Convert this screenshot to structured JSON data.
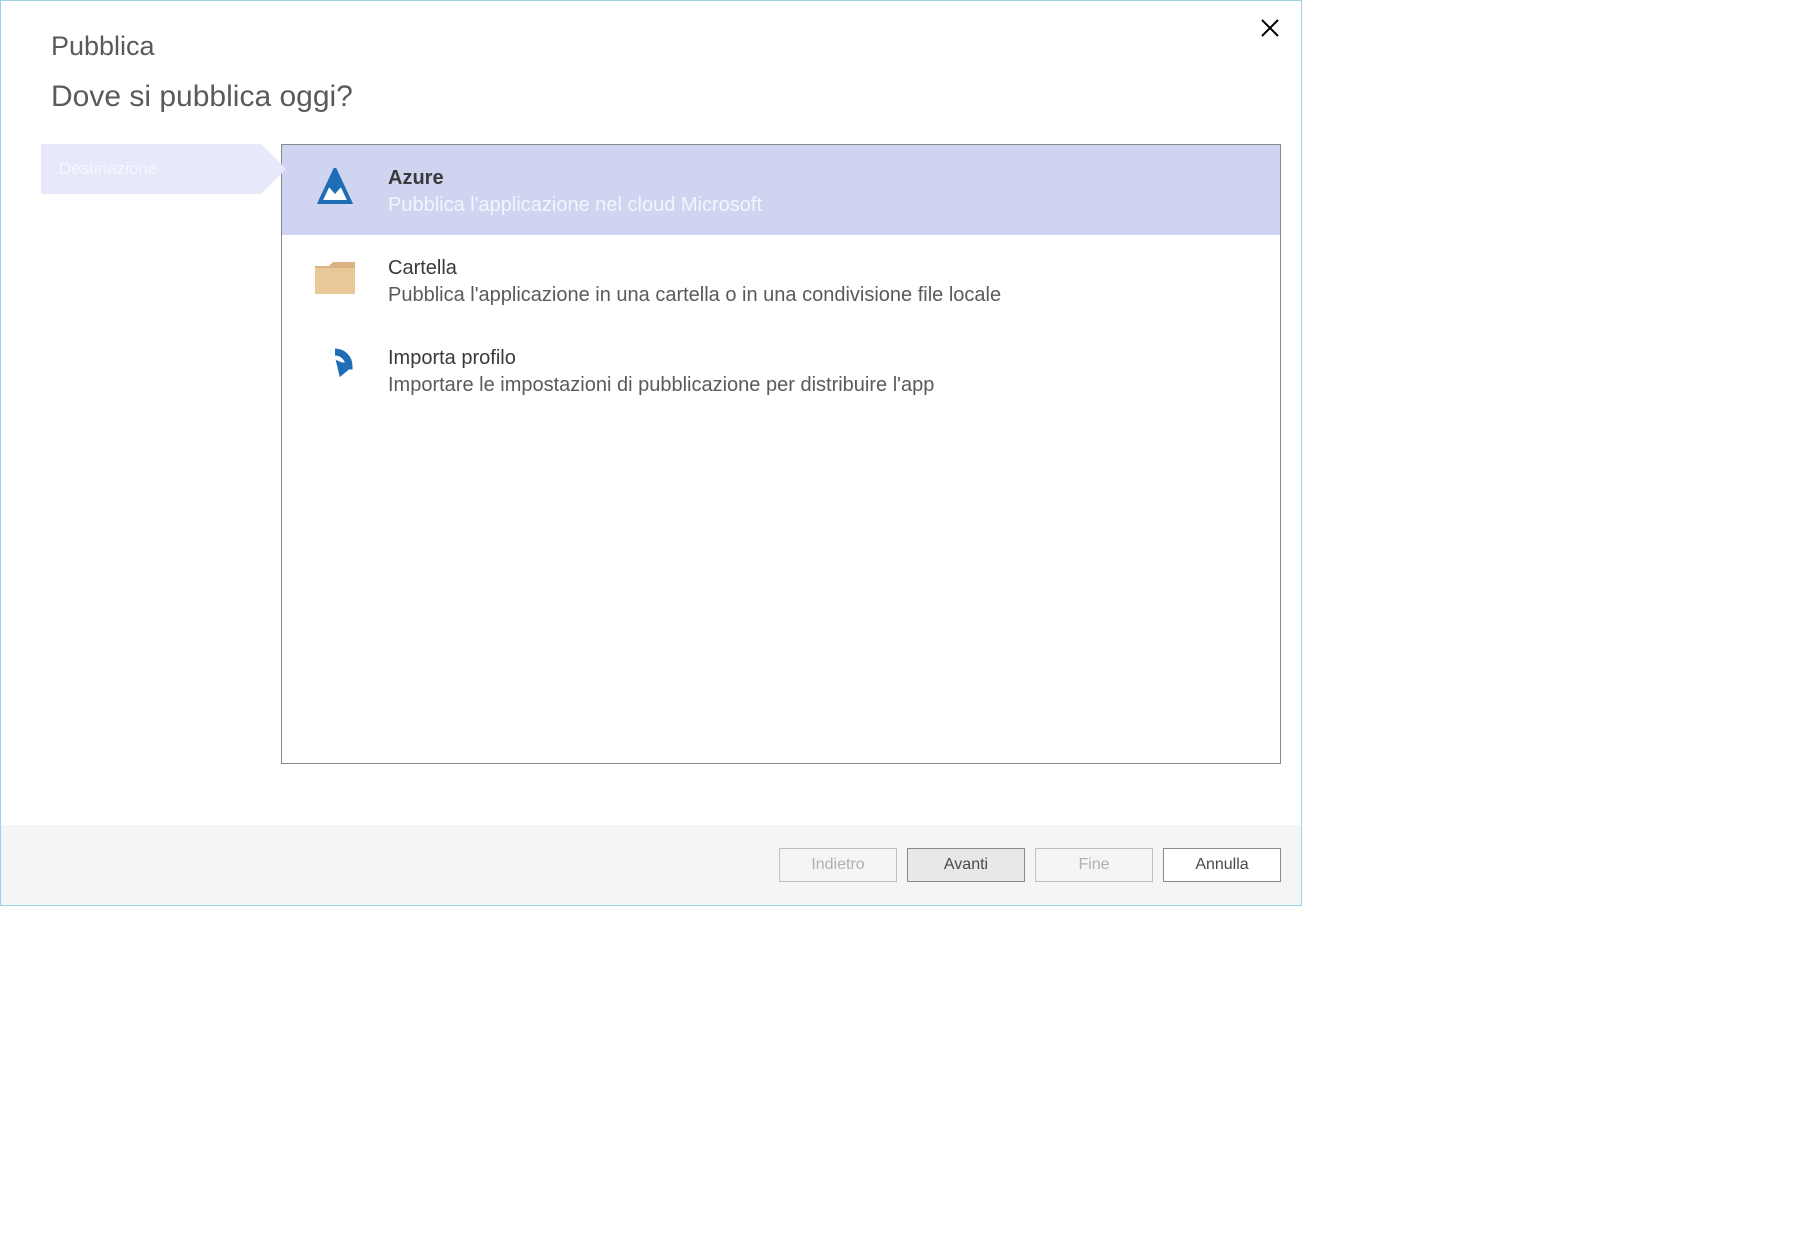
{
  "dialog": {
    "title": "Pubblica",
    "subtitle": "Dove si pubblica oggi?"
  },
  "sidebar": {
    "step": "Destinazione"
  },
  "options": {
    "azure": {
      "title": "Azure",
      "desc": "Pubblica l'applicazione nel cloud Microsoft"
    },
    "folder": {
      "title": "Cartella",
      "desc": "Pubblica l'applicazione in una cartella o in una condivisione file locale"
    },
    "import": {
      "title": "Importa profilo",
      "desc": "Importare le impostazioni di pubblicazione per distribuire l'app"
    }
  },
  "buttons": {
    "back": "Indietro",
    "next": "Avanti",
    "finish": "Fine",
    "cancel": "Annulla"
  }
}
